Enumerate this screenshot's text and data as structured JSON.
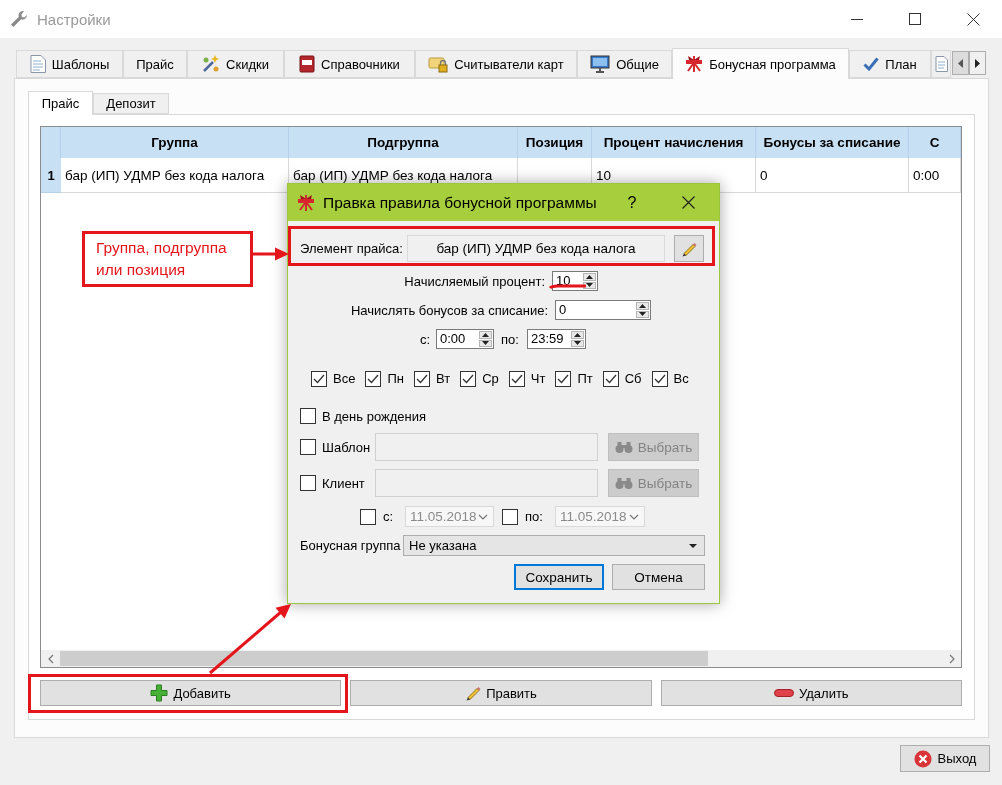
{
  "window": {
    "title": "Настройки"
  },
  "tabs": [
    {
      "label": "Шаблоны",
      "selected": false
    },
    {
      "label": "Прайс",
      "selected": false
    },
    {
      "label": "Скидки",
      "selected": false
    },
    {
      "label": "Справочники",
      "selected": false
    },
    {
      "label": "Считыватели карт",
      "selected": false
    },
    {
      "label": "Общие",
      "selected": false
    },
    {
      "label": "Бонусная программа",
      "selected": true
    },
    {
      "label": "План",
      "selected": false
    }
  ],
  "subtabs": [
    {
      "label": "Прайс",
      "selected": true
    },
    {
      "label": "Депозит",
      "selected": false
    }
  ],
  "table": {
    "columns": [
      "Группа",
      "Подгруппа",
      "Позиция",
      "Процент начисления",
      "Бонусы за списание",
      "С"
    ],
    "rows": [
      {
        "number": "1",
        "cells": [
          "бар (ИП) УДМР без кода налога",
          "бар (ИП) УДМР без кода налога",
          null,
          "10",
          "0",
          "0:00"
        ]
      }
    ]
  },
  "actions": [
    {
      "kind": "add",
      "label": "Добавить"
    },
    {
      "kind": "edit",
      "label": "Править"
    },
    {
      "kind": "delete",
      "label": "Удалить"
    }
  ],
  "exit_button": {
    "label": "Выход"
  },
  "dialog": {
    "title": "Правка правила бонусной программы",
    "help": "?",
    "price_element": {
      "label": "Элемент прайса:",
      "value": "бар (ИП) УДМР без кода налога"
    },
    "percent": {
      "label": "Начисляемый процент:",
      "value": "10"
    },
    "writeoff_bonus": {
      "label": "Начислять бонусов за списание:",
      "value": "0"
    },
    "time_from": {
      "label": "с:",
      "value": "0:00"
    },
    "time_to": {
      "label": "по:",
      "value": "23:59"
    },
    "days": [
      {
        "label": "Все",
        "checked": true
      },
      {
        "label": "Пн",
        "checked": true
      },
      {
        "label": "Вт",
        "checked": true
      },
      {
        "label": "Ср",
        "checked": true
      },
      {
        "label": "Чт",
        "checked": true
      },
      {
        "label": "Пт",
        "checked": true
      },
      {
        "label": "Сб",
        "checked": true
      },
      {
        "label": "Вс",
        "checked": true
      }
    ],
    "birthday": {
      "label": "В день рождения",
      "checked": false
    },
    "template": {
      "label": "Шаблон",
      "checked": false,
      "disabled": true,
      "button": "Выбрать"
    },
    "client": {
      "label": "Клиент",
      "checked": false,
      "disabled": true,
      "button": "Выбрать"
    },
    "date_from": {
      "label": "с:",
      "checked": false,
      "disabled": true,
      "value": "11.05.2018"
    },
    "date_to": {
      "label": "по:",
      "checked": false,
      "disabled": true,
      "value": "11.05.2018"
    },
    "bonus_group": {
      "label": "Бонусная группа",
      "value": "Не указана"
    },
    "buttons": [
      {
        "label": "Сохранить",
        "focused": true
      },
      {
        "label": "Отмена",
        "focused": false
      }
    ]
  },
  "annotation": {
    "callout": "Группа, подгруппа\nили позиция"
  }
}
